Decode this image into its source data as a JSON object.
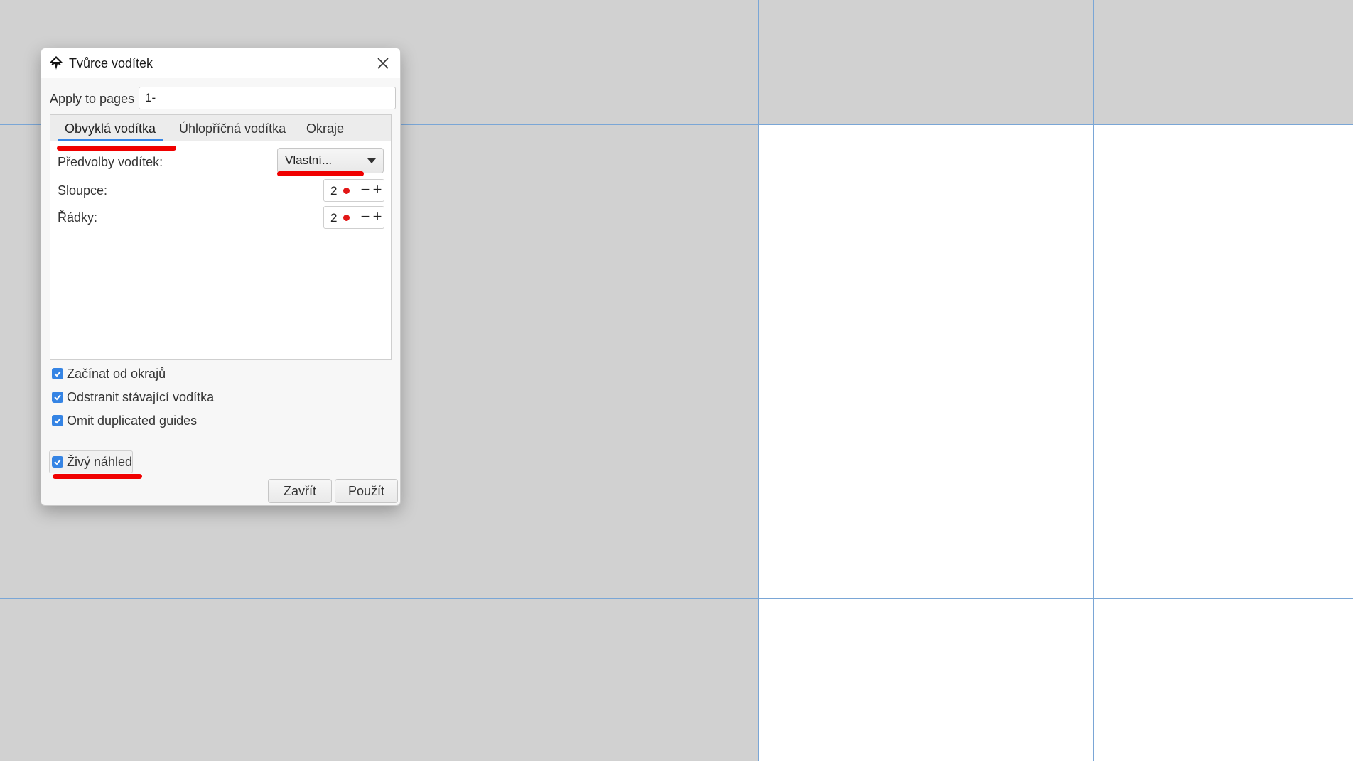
{
  "dialog": {
    "title": "Tvůrce vodítek",
    "apply_label": "Apply to pages",
    "apply_value": "1-",
    "tabs": [
      {
        "label": "Obvyklá vodítka",
        "active": true
      },
      {
        "label": "Úhlopříčná vodítka",
        "active": false
      },
      {
        "label": "Okraje",
        "active": false
      }
    ],
    "presets_label": "Předvolby vodítek:",
    "presets_value": "Vlastní...",
    "columns_label": "Sloupce:",
    "columns_value": "2",
    "rows_label": "Řádky:",
    "rows_value": "2",
    "spin_minus": "−",
    "spin_plus": "+",
    "checkboxes": [
      {
        "label": "Začínat od okrajů",
        "checked": true
      },
      {
        "label": "Odstranit stávající vodítka",
        "checked": true
      },
      {
        "label": "Omit duplicated guides",
        "checked": true
      }
    ],
    "live_preview": {
      "label": "Živý náhled",
      "checked": true
    },
    "close_label": "Zavřít",
    "apply_button_label": "Použít"
  },
  "colors": {
    "canvas": "#d1d1d1",
    "page": "#ffffff",
    "guide": "#7aa6d6",
    "accent": "#3584e4",
    "annotation": "#f00000"
  }
}
